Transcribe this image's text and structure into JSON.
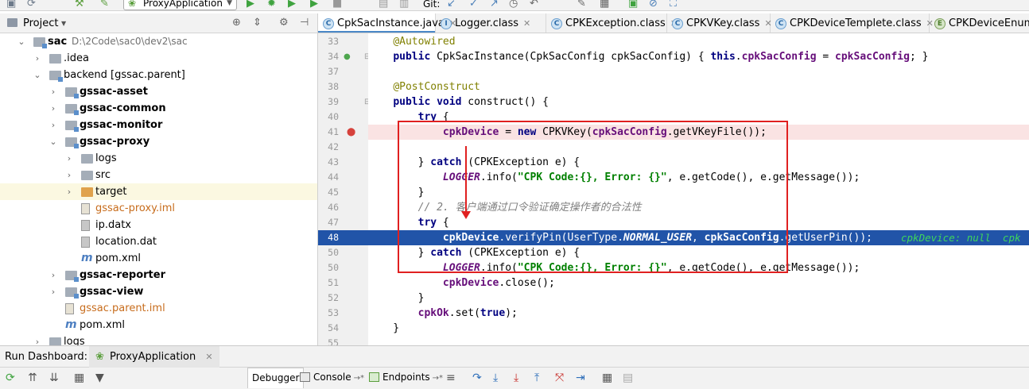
{
  "toolbar": {
    "run_config": "ProxyApplication",
    "git_label": "Git:"
  },
  "project_panel": {
    "title": "Project",
    "tree": [
      {
        "name": "sac",
        "path": "D:\\2Code\\sac0\\dev2\\sac",
        "bold": true,
        "icon": "module-folder-icon",
        "expanded": true
      },
      {
        "name": ".idea",
        "icon": "folder-icon",
        "expanded": false
      },
      {
        "name": "backend [gssac.parent]",
        "icon": "module-folder-icon",
        "expanded": true
      },
      {
        "name": "gssac-asset",
        "bold": true,
        "icon": "module-folder-icon",
        "expanded": false
      },
      {
        "name": "gssac-common",
        "bold": true,
        "icon": "module-folder-icon",
        "expanded": false
      },
      {
        "name": "gssac-monitor",
        "bold": true,
        "icon": "module-folder-icon",
        "expanded": false
      },
      {
        "name": "gssac-proxy",
        "bold": true,
        "icon": "module-folder-icon",
        "expanded": true
      },
      {
        "name": "logs",
        "icon": "folder-icon",
        "expanded": false
      },
      {
        "name": "src",
        "icon": "folder-icon",
        "expanded": false
      },
      {
        "name": "target",
        "icon": "excluded-folder-icon",
        "expanded": false,
        "highlighted": true
      },
      {
        "name": "gssac-proxy.iml",
        "icon": "iml-file-icon",
        "orange": true
      },
      {
        "name": "ip.datx",
        "icon": "file-icon"
      },
      {
        "name": "location.dat",
        "icon": "file-icon"
      },
      {
        "name": "pom.xml",
        "icon": "maven-icon"
      },
      {
        "name": "gssac-reporter",
        "bold": true,
        "icon": "module-folder-icon",
        "expanded": false
      },
      {
        "name": "gssac-view",
        "bold": true,
        "icon": "module-folder-icon",
        "expanded": false
      },
      {
        "name": "gssac.parent.iml",
        "icon": "iml-file-icon",
        "orange": true
      },
      {
        "name": "pom.xml",
        "icon": "maven-icon"
      },
      {
        "name": "logs",
        "icon": "folder-icon",
        "expanded": false
      }
    ]
  },
  "editor": {
    "tabs": [
      {
        "label": "CpkSacInstance.java",
        "icon": "class-icon",
        "active": true
      },
      {
        "label": "Logger.class",
        "icon": "interface-icon"
      },
      {
        "label": "CPKException.class",
        "icon": "class-icon"
      },
      {
        "label": "CPKVKey.class",
        "icon": "class-icon"
      },
      {
        "label": "CPKDeviceTemplete.class",
        "icon": "class-icon"
      },
      {
        "label": "CPKDeviceEnum.c",
        "icon": "enum-icon"
      }
    ],
    "lines": [
      {
        "n": "33",
        "text": "    @Autowired"
      },
      {
        "n": "34",
        "text": "    public CpkSacInstance(CpkSacConfig cpkSacConfig) { this.cpkSacConfig = cpkSacConfig; }"
      },
      {
        "n": "37",
        "text": ""
      },
      {
        "n": "38",
        "text": "    @PostConstruct"
      },
      {
        "n": "39",
        "text": "    public void construct() {"
      },
      {
        "n": "40",
        "text": "        try {"
      },
      {
        "n": "41",
        "text": "            cpkDevice = new CPKVKey(cpkSacConfig.getVKeyFile());"
      },
      {
        "n": "42",
        "text": ""
      },
      {
        "n": "43",
        "text": "        } catch (CPKException e) {"
      },
      {
        "n": "44",
        "text": "            LOGGER.info(\"CPK Code:{}, Error: {}\", e.getCode(), e.getMessage());"
      },
      {
        "n": "45",
        "text": "        }"
      },
      {
        "n": "46",
        "text": "        // 2. 客户端通过口令验证确定操作者的合法性"
      },
      {
        "n": "47",
        "text": "        try {"
      },
      {
        "n": "48",
        "text": "            cpkDevice.verifyPin(UserType.NORMAL_USER, cpkSacConfig.getUserPin());"
      },
      {
        "n": "50",
        "text": "        } catch (CPKException e) {"
      },
      {
        "n": "50",
        "text": "            LOGGER.info(\"CPK Code:{}, Error: {}\", e.getCode(), e.getMessage());"
      },
      {
        "n": "51",
        "text": "            cpkDevice.close();"
      },
      {
        "n": "52",
        "text": "        }"
      },
      {
        "n": "53",
        "text": "        cpkOk.set(true);"
      },
      {
        "n": "54",
        "text": "    }"
      },
      {
        "n": "55",
        "text": ""
      }
    ],
    "inline_debug": "cpkDevice: null  cpk"
  },
  "run_dashboard": {
    "label": "Run Dashboard:",
    "tab": "ProxyApplication"
  },
  "debug_bar": {
    "debugger": "Debugger",
    "console": "Console",
    "console_suffix": "→*",
    "endpoints": "Endpoints",
    "endpoints_suffix": "→*"
  },
  "colors": {
    "exec_line": "#2154a8",
    "breakpoint_line": "#fae3e3",
    "annotation_box": "#e02020",
    "inline_debug": "#3fd65b"
  }
}
